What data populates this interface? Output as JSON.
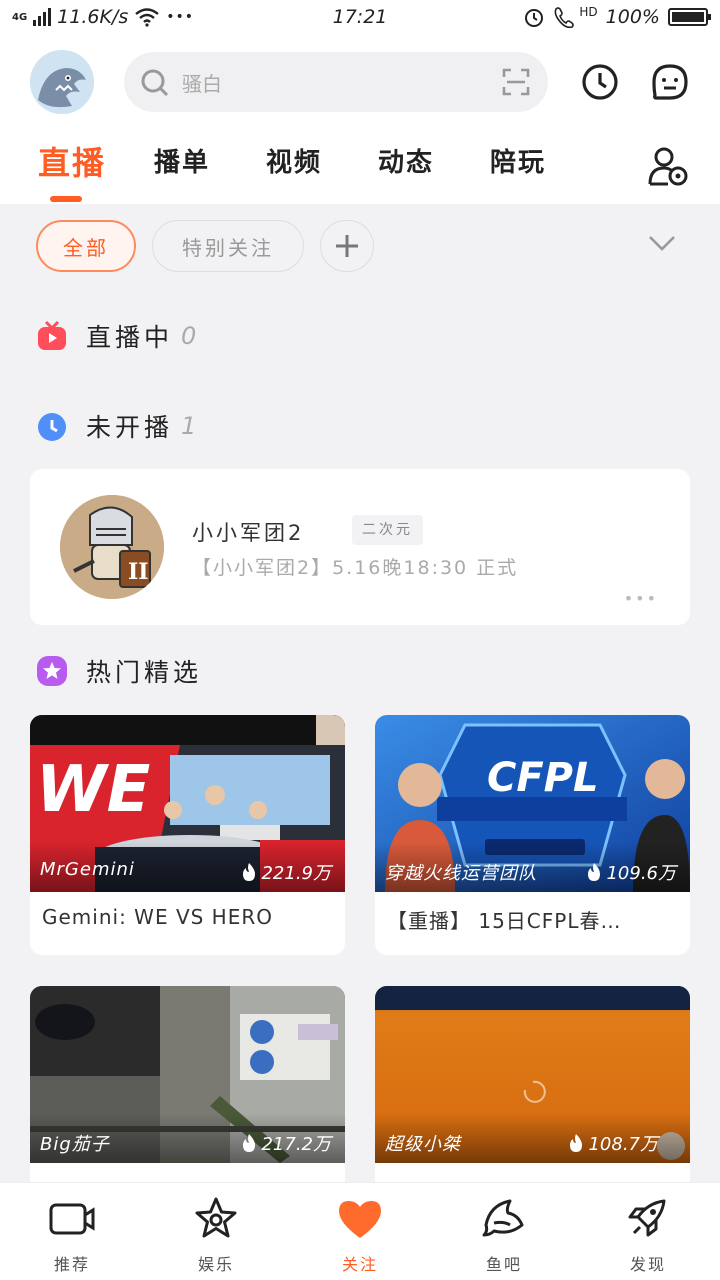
{
  "status_bar": {
    "network": "4G",
    "speed": "11.6K/s",
    "dots": "•••",
    "time": "17:21",
    "hd": "HD",
    "battery": "100%"
  },
  "header": {
    "search_placeholder": "骚白"
  },
  "tabs": [
    {
      "label": "直播",
      "active": true
    },
    {
      "label": "播单"
    },
    {
      "label": "视频"
    },
    {
      "label": "动态"
    },
    {
      "label": "陪玩"
    }
  ],
  "filters": {
    "all": "全部",
    "special": "特别关注"
  },
  "sections": {
    "live": {
      "title": "直播中",
      "count": "0"
    },
    "offline": {
      "title": "未开播",
      "count": "1"
    },
    "hot": {
      "title": "热门精选"
    }
  },
  "streamer": {
    "name": "小小军团2",
    "tag": "二次元",
    "desc": "【小小军团2】5.16晚18:30 正式",
    "more": "•••"
  },
  "videos": [
    {
      "anchor": "MrGemini",
      "views": "221.9万",
      "title": "Gemini: WE VS HERO"
    },
    {
      "anchor": "穿越火线运营团队",
      "views": "109.6万",
      "title": "【重播】 15日CFPL春…"
    },
    {
      "anchor": "Big茄子",
      "views": "217.2万",
      "title": ""
    },
    {
      "anchor": "超级小桀",
      "views": "108.7万",
      "title": ""
    }
  ],
  "bottom_nav": [
    {
      "label": "推荐"
    },
    {
      "label": "娱乐"
    },
    {
      "label": "关注",
      "active": true
    },
    {
      "label": "鱼吧"
    },
    {
      "label": "发现"
    }
  ],
  "colors": {
    "accent": "#ff5d23",
    "page_bg": "#f2f2f4"
  }
}
